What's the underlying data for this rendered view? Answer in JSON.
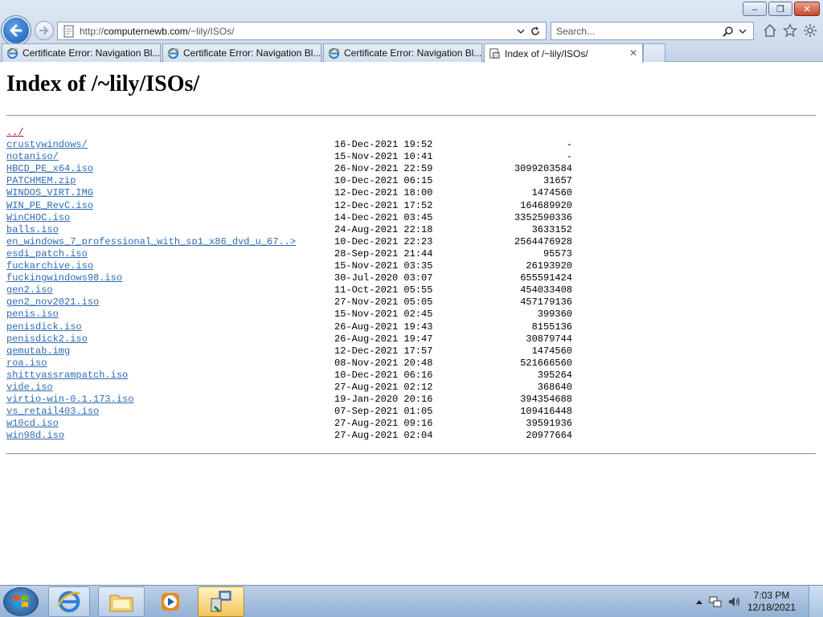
{
  "window": {
    "minimize_label": "‒",
    "maximize_label": "❐",
    "close_label": "✕"
  },
  "address_bar": {
    "url_prefix": "http://",
    "url_domain": "computernewb.com",
    "url_path": "/~lily/ISOs/"
  },
  "search": {
    "placeholder": "Search..."
  },
  "tabs": [
    {
      "label": "Certificate Error: Navigation Bl...",
      "active": false,
      "icon": "ie-icon"
    },
    {
      "label": "Certificate Error: Navigation Bl...",
      "active": false,
      "icon": "ie-icon"
    },
    {
      "label": "Certificate Error: Navigation Bl...",
      "active": false,
      "icon": "ie-icon"
    },
    {
      "label": "Index of /~lily/ISOs/",
      "active": true,
      "icon": "page-icon",
      "close": "✕"
    }
  ],
  "page": {
    "title": "Index of /~lily/ISOs/",
    "entries": [
      {
        "name": "../",
        "date": "",
        "size": ""
      },
      {
        "name": "crustywindows/",
        "date": "16-Dec-2021 19:52",
        "size": "-"
      },
      {
        "name": "notaniso/",
        "date": "15-Nov-2021 10:41",
        "size": "-"
      },
      {
        "name": "HBCD_PE_x64.iso",
        "date": "26-Nov-2021 22:59",
        "size": "3099203584"
      },
      {
        "name": "PATCHMEM.zip",
        "date": "10-Dec-2021 06:15",
        "size": "31657"
      },
      {
        "name": "WINDOS_VIRT.IMG",
        "date": "12-Dec-2021 18:00",
        "size": "1474560"
      },
      {
        "name": "WIN_PE_RevC.iso",
        "date": "12-Dec-2021 17:52",
        "size": "164689920"
      },
      {
        "name": "WinCHOC.iso",
        "date": "14-Dec-2021 03:45",
        "size": "3352590336"
      },
      {
        "name": "balls.iso",
        "date": "24-Aug-2021 22:18",
        "size": "3633152"
      },
      {
        "name": "en_windows_7_professional_with_sp1_x86_dvd_u_67..>",
        "date": "10-Dec-2021 22:23",
        "size": "2564476928"
      },
      {
        "name": "esdi_patch.iso",
        "date": "28-Sep-2021 21:44",
        "size": "95573"
      },
      {
        "name": "fuckarchive.iso",
        "date": "15-Nov-2021 03:35",
        "size": "26193920"
      },
      {
        "name": "fuckingwindows98.iso",
        "date": "30-Jul-2020 03:07",
        "size": "655591424"
      },
      {
        "name": "gen2.iso",
        "date": "11-Oct-2021 05:55",
        "size": "454033408"
      },
      {
        "name": "gen2_nov2021.iso",
        "date": "27-Nov-2021 05:05",
        "size": "457179136"
      },
      {
        "name": "penis.iso",
        "date": "15-Nov-2021 02:45",
        "size": "399360"
      },
      {
        "name": "penisdick.iso",
        "date": "26-Aug-2021 19:43",
        "size": "8155136"
      },
      {
        "name": "penisdick2.iso",
        "date": "26-Aug-2021 19:47",
        "size": "30879744"
      },
      {
        "name": "qemutab.img",
        "date": "12-Dec-2021 17:57",
        "size": "1474560"
      },
      {
        "name": "roa.iso",
        "date": "08-Nov-2021 20:48",
        "size": "521666560"
      },
      {
        "name": "shittyassrampatch.iso",
        "date": "10-Dec-2021 06:16",
        "size": "395264"
      },
      {
        "name": "vide.iso",
        "date": "27-Aug-2021 02:12",
        "size": "368640"
      },
      {
        "name": "virtio-win-0.1.173.iso",
        "date": "19-Jan-2020 20:16",
        "size": "394354688"
      },
      {
        "name": "vs_retail403.iso",
        "date": "07-Sep-2021 01:05",
        "size": "109416448"
      },
      {
        "name": "w10cd.iso",
        "date": "27-Aug-2021 09:16",
        "size": "39591936"
      },
      {
        "name": "win98d.iso",
        "date": "27-Aug-2021 02:04",
        "size": "20977664"
      }
    ]
  },
  "taskbar": {
    "pinned": [
      "ie-icon",
      "explorer-folder-icon",
      "media-player-icon",
      "network-setup-icon"
    ],
    "clock_time": "7:03 PM",
    "clock_date": "12/18/2021"
  },
  "colors": {
    "link": "#2e6bb3",
    "visited_parent_link": "#a01050",
    "taskbar": "#a9c2df",
    "active_task": "#f0c45a"
  }
}
